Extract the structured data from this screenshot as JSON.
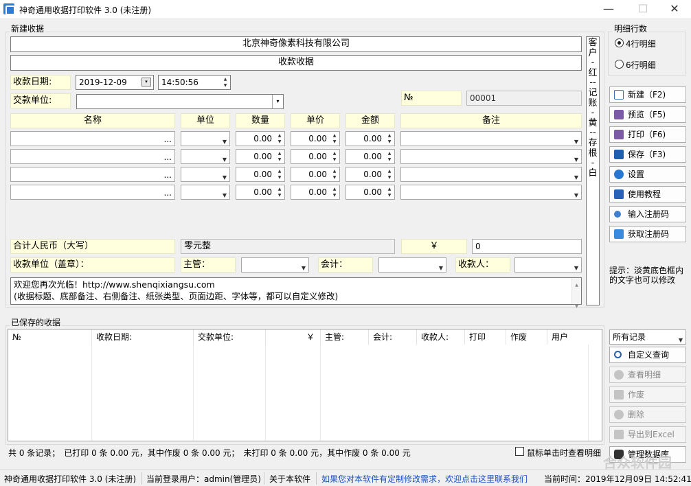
{
  "window": {
    "title": "神奇通用收据打印软件 3.0 (未注册)",
    "minimize": "—",
    "maximize": "☐",
    "close": "✕"
  },
  "new_receipt": {
    "group_label": "新建收据",
    "company": "北京神奇像素科技有限公司",
    "receipt_title": "收款收据",
    "date_label": "收款日期:",
    "date_value": "2019-12-09",
    "time_value": "14:50:56",
    "payer_label": "交款单位:",
    "payer_value": "",
    "no_label": "№",
    "no_value": "00001",
    "columns": [
      "名称",
      "单位",
      "数量",
      "单价",
      "金额",
      "备注"
    ],
    "rows": [
      {
        "qty": "0.00",
        "price": "0.00",
        "amount": "0.00"
      },
      {
        "qty": "0.00",
        "price": "0.00",
        "amount": "0.00"
      },
      {
        "qty": "0.00",
        "price": "0.00",
        "amount": "0.00"
      },
      {
        "qty": "0.00",
        "price": "0.00",
        "amount": "0.00"
      }
    ],
    "dots": "...",
    "total_rmb_label": "合计人民币（大写）",
    "total_rmb_value": "零元整",
    "yen_symbol": "￥",
    "total_value": "0",
    "payee_unit_label": "收款单位（盖章）：",
    "supervisor_label": "主管：",
    "accountant_label": "会计：",
    "receiver_label": "收款人：",
    "memo_line1": "欢迎您再次光临！http://www.shenqixiangsu.com",
    "memo_line2": "(收据标题、底部备注、右侧备注、纸张类型、页面边距、字体等，都可以自定义修改)",
    "side_note": [
      "客",
      "户",
      "-",
      "红",
      "--",
      "记",
      "账",
      "-",
      "黄",
      "--",
      "存",
      "根",
      "-",
      "白"
    ]
  },
  "detail_rows": {
    "group_label": "明细行数",
    "option4": "4行明细",
    "option6": "6行明细",
    "selected": "4行明细"
  },
  "side_buttons": [
    {
      "label": "新建（F2)",
      "icon": "new-doc-icon"
    },
    {
      "label": "预览（F5)",
      "icon": "printer-icon"
    },
    {
      "label": "打印（F6)",
      "icon": "printer-icon"
    },
    {
      "label": "保存（F3)",
      "icon": "save-icon"
    },
    {
      "label": "设置",
      "icon": "gear-icon"
    },
    {
      "label": "使用教程",
      "icon": "book-icon"
    },
    {
      "label": "输入注册码",
      "icon": "key-icon"
    },
    {
      "label": "获取注册码",
      "icon": "gift-icon"
    }
  ],
  "hint": "提示：淡黄底色框内的文字也可以修改",
  "saved": {
    "group_label": "已保存的收据",
    "columns": [
      "№",
      "收款日期:",
      "交款单位:",
      "￥",
      "主管:",
      "会计:",
      "收款人:",
      "打印",
      "作废",
      "用户"
    ],
    "filter_value": "所有记录",
    "buttons": [
      {
        "label": "自定义查询",
        "icon": "search-icon",
        "enabled": true
      },
      {
        "label": "查看明细",
        "icon": "view-icon",
        "enabled": false
      },
      {
        "label": "作废",
        "icon": "void-icon",
        "enabled": false
      },
      {
        "label": "删除",
        "icon": "delete-icon",
        "enabled": false
      },
      {
        "label": "导出到Excel",
        "icon": "export-icon",
        "enabled": false
      },
      {
        "label": "管理数据库",
        "icon": "database-icon",
        "enabled": true
      }
    ],
    "summary": "共 0 条记录；　已打印 0 条 0.00 元，其中作废 0 条 0.00 元；　未打印 0 条 0.00 元，其中作废 0 条 0.00 元",
    "checkbox_label": "鼠标单击时查看明细"
  },
  "statusbar": {
    "app": "神奇通用收据打印软件 3.0 (未注册)",
    "user": "当前登录用户：admin(管理员)",
    "about": "关于本软件",
    "custom_link": "如果您对本软件有定制修改需求，欢迎点击这里联系我们",
    "time": "当前时间：2019年12月09日 14:52:41"
  },
  "watermark": "合众软件园",
  "colors": {
    "label_bg": "#ffffdd",
    "link": "#1a4fc4",
    "accent": "#2b7cd3"
  }
}
